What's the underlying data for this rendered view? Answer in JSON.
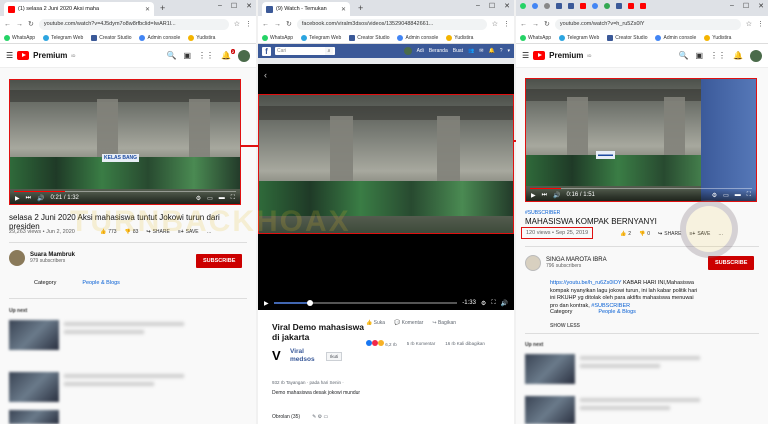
{
  "left": {
    "tab_title": "(1) selasa 2 Juni 2020 Aksi maha",
    "url": "youtube.com/watch?v=4J5dym7o8w8rfbclid=IwAR1l...",
    "bookmarks": [
      "WhatsApp",
      "Telegram Web",
      "Creator Studio",
      "Admin console",
      "Yudistira"
    ],
    "brand": "Premium",
    "brand_sup": "ID",
    "notif_count": "2",
    "time": "0:21 / 1:32",
    "title": "selasa 2 Juni 2020 Aksi mahasiswa tuntut Jokowi turun dari presiden",
    "meta": "29,263 views • Jun 2, 2020",
    "likes": "773",
    "dislikes": "83",
    "share": "SHARE",
    "save": "SAVE",
    "channel": "Suara Mambruk",
    "subscribers": "979 subscribers",
    "subscribe": "SUBSCRIBE",
    "category_label": "Category",
    "category_value": "People & Blogs",
    "upnext": "Up next",
    "banner": "KELAS BANG"
  },
  "middle": {
    "tab_title": "(9) Watch - Temukan",
    "url": "facebook.com/viralm3dsos/videos/135290488426​61...",
    "bookmarks": [
      "WhatsApp",
      "Telegram Web",
      "Creator Studio",
      "Admin console",
      "Yudistira"
    ],
    "search_placeholder": "Cari",
    "nav": [
      "Adi",
      "Beranda",
      "Buat"
    ],
    "time": "-1:33",
    "title": "Viral Demo mahasiswa di jakarta",
    "actions": [
      "Suka",
      "Komentar",
      "Bagikan"
    ],
    "reactions": "6,2 rb",
    "comments": "5 rb Komentar",
    "shares": "16 rb Kali dibagikan",
    "page_name": "Viral medsos",
    "follow": "Ikuti",
    "views": "932 rb Tayangan · pada hari Senin ·",
    "description": "Demo mahasiswa desak jokowi mundur",
    "comments_label": "Obrolan (35)"
  },
  "right": {
    "url": "youtube.com/watch?v=h_ru5Zs0lY",
    "bookmarks": [
      "WhatsApp",
      "Telegram Web",
      "Creator Studio",
      "Admin console",
      "Yudistira"
    ],
    "brand": "Premium",
    "brand_sup": "ID",
    "time": "0:16 / 1:51",
    "hashtag": "#SUBSCRIBER",
    "title": "MAHASISWA KOMPAK BERNYANYI",
    "meta": "120 views • Sep 25, 2019",
    "likes": "2",
    "dislikes": "0",
    "share": "SHARE",
    "save": "SAVE",
    "channel": "SINGA MAROTA IBRA",
    "subscribers": "796 subscribers",
    "subscribe": "SUBSCRIBE",
    "desc_link": "https://youtu.be/h_ru6Zs0lOY",
    "desc_text": " KABAR HARI INI,Mahasiswa kompak nyanyikan lagu jokowi turun, ini lah kabar politik hari ini RKUHP yg ditolak oleh para aktifis mahasiswa menuwai pro dan kontrak, ",
    "desc_tag": "#SUBSCRIBER",
    "category_label": "Category",
    "category_value": "People & Blogs",
    "show_less": "SHOW LESS",
    "upnext": "Up next"
  },
  "watermark": "TURNBACKHOAX",
  "colors": {
    "accent": "#e01010",
    "yt_red": "#cc0000",
    "fb_blue": "#3b5998",
    "link": "#065fd4"
  }
}
